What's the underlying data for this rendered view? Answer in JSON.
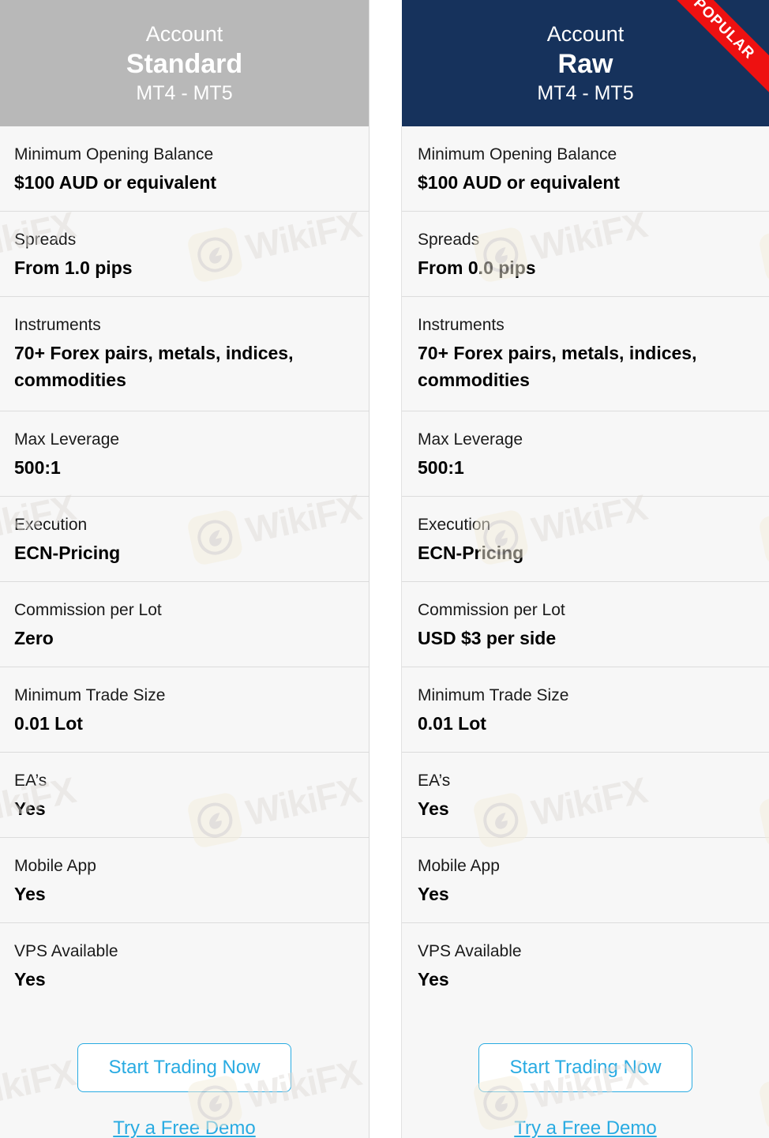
{
  "comparison": {
    "columns": [
      {
        "id": "standard",
        "eyebrow": "Account",
        "plan": "Standard",
        "platforms": "MT4 - MT5",
        "header_bg": "#b8b8b8",
        "badge": null,
        "rows": [
          {
            "label": "Minimum Opening Balance",
            "value": "$100 AUD or equivalent"
          },
          {
            "label": "Spreads",
            "value": "From 1.0 pips"
          },
          {
            "label": "Instruments",
            "value": "70+ Forex pairs, metals, indices, commodities"
          },
          {
            "label": "Max Leverage",
            "value": "500:1"
          },
          {
            "label": "Execution",
            "value": "ECN-Pricing"
          },
          {
            "label": "Commission per Lot",
            "value": "Zero"
          },
          {
            "label": "Minimum Trade Size",
            "value": "0.01 Lot"
          },
          {
            "label": "EA’s",
            "value": "Yes"
          },
          {
            "label": "Mobile App",
            "value": "Yes"
          },
          {
            "label": "VPS Available",
            "value": "Yes"
          }
        ],
        "cta_button": "Start Trading Now",
        "cta_link": "Try a Free Demo"
      },
      {
        "id": "raw",
        "eyebrow": "Account",
        "plan": "Raw",
        "platforms": "MT4 - MT5",
        "header_bg": "#16325c",
        "badge": "POPULAR",
        "rows": [
          {
            "label": "Minimum Opening Balance",
            "value": "$100 AUD or equivalent"
          },
          {
            "label": "Spreads",
            "value": "From 0.0 pips"
          },
          {
            "label": "Instruments",
            "value": "70+ Forex pairs, metals, indices, commodities"
          },
          {
            "label": "Max Leverage",
            "value": "500:1"
          },
          {
            "label": "Execution",
            "value": "ECN-Pricing"
          },
          {
            "label": "Commission per Lot",
            "value": "USD $3 per side"
          },
          {
            "label": "Minimum Trade Size",
            "value": "0.01 Lot"
          },
          {
            "label": "EA’s",
            "value": "Yes"
          },
          {
            "label": "Mobile App",
            "value": "Yes"
          },
          {
            "label": "VPS Available",
            "value": "Yes"
          }
        ],
        "cta_button": "Start Trading Now",
        "cta_link": "Try a Free Demo"
      }
    ]
  },
  "watermark": {
    "text": "WikiFX",
    "icon": "wikifx-eagle-icon"
  },
  "colors": {
    "accent_cyan": "#29abe2",
    "badge_red": "#ee1111",
    "header_gray": "#b8b8b8",
    "header_navy": "#16325c",
    "row_bg": "#f7f7f7",
    "divider": "#dcdcdc"
  }
}
